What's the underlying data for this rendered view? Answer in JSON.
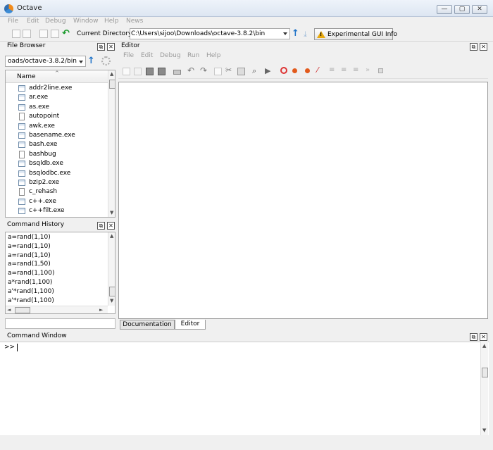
{
  "window": {
    "title": "Octave"
  },
  "menubar": [
    "File",
    "Edit",
    "Debug",
    "Window",
    "Help",
    "News"
  ],
  "toolbar": {
    "current_directory_label": "Current Directory:",
    "current_directory_value": "C:\\Users\\sijoo\\Downloads\\octave-3.8.2\\bin",
    "gui_info_button": "Experimental GUI Info"
  },
  "file_browser": {
    "title": "File Browser",
    "path_value": "oads/octave-3.8.2/bin",
    "column_header": "Name",
    "files": [
      {
        "name": "addr2line.exe",
        "type": "exe"
      },
      {
        "name": "ar.exe",
        "type": "exe"
      },
      {
        "name": "as.exe",
        "type": "exe"
      },
      {
        "name": "autopoint",
        "type": "file"
      },
      {
        "name": "awk.exe",
        "type": "exe"
      },
      {
        "name": "basename.exe",
        "type": "exe"
      },
      {
        "name": "bash.exe",
        "type": "exe"
      },
      {
        "name": "bashbug",
        "type": "file"
      },
      {
        "name": "bsqldb.exe",
        "type": "exe"
      },
      {
        "name": "bsqlodbc.exe",
        "type": "exe"
      },
      {
        "name": "bzip2.exe",
        "type": "exe"
      },
      {
        "name": "c_rehash",
        "type": "file"
      },
      {
        "name": "c++.exe",
        "type": "exe"
      },
      {
        "name": "c++filt.exe",
        "type": "exe"
      }
    ]
  },
  "command_history": {
    "title": "Command History",
    "entries": [
      "a=rand(1,10)",
      "a=rand(1,10)",
      "a=rand(1,10)",
      "a=rand(1,50)",
      "a=rand(1,100)",
      "a*rand(1,100)",
      "a'*rand(1,100)",
      "a'*rand(1,100)"
    ]
  },
  "editor": {
    "title": "Editor",
    "menu": [
      "File",
      "Edit",
      "Debug",
      "Run",
      "Help"
    ]
  },
  "tabs": {
    "documentation": "Documentation",
    "editor": "Editor"
  },
  "command_window": {
    "title": "Command Window",
    "prompt": ">>"
  }
}
